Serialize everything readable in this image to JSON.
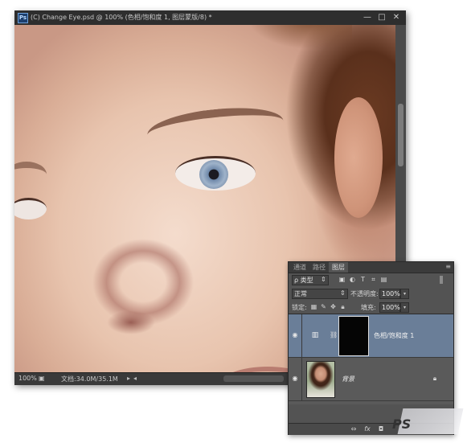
{
  "document": {
    "app_icon": "Ps",
    "title": "(C) Change Eye.psd @ 100% (色相/饱和度 1, 图层蒙版/8) *",
    "window_buttons": [
      "—",
      "□",
      "✕"
    ],
    "status_zoom": "100%",
    "status_info": "文档:34.0M/35.1M",
    "status_arrow": "▸",
    "scroll_arrow": "◂"
  },
  "layers_panel": {
    "tabs": [
      "通道",
      "路径",
      "图层"
    ],
    "active_tab": "图层",
    "menu_icon": "≡",
    "filter_kind": "ρ 类型",
    "filter_icons": [
      "image-filter-icon",
      "adjustment-filter-icon",
      "type-filter-icon",
      "shape-filter-icon",
      "smart-object-filter-icon"
    ],
    "blend_mode": "正常",
    "opacity_label": "不透明度:",
    "opacity_value": "100%",
    "lock_label": "锁定:",
    "fill_label": "填充:",
    "fill_value": "100%",
    "layers": [
      {
        "name": "色相/饱和度 1",
        "type": "adjustment",
        "visible": true,
        "selected": true
      },
      {
        "name": "背景",
        "type": "background",
        "visible": true,
        "selected": false,
        "locked": true
      }
    ],
    "bottom_icons": [
      "link-layers-icon",
      "fx-icon",
      "add-mask-icon"
    ]
  },
  "watermark": {
    "text": "PS"
  }
}
